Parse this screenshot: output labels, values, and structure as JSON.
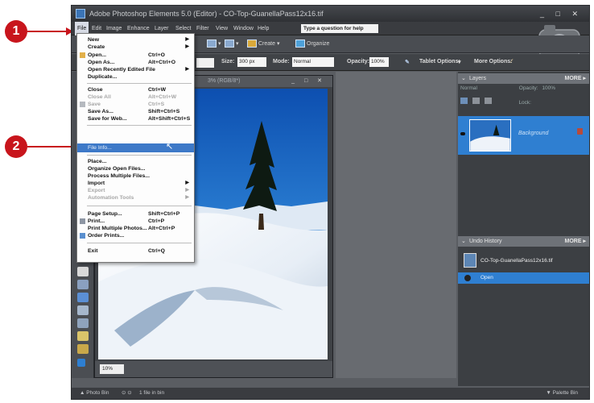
{
  "window": {
    "title": "Adobe Photoshop Elements 5.0 (Editor) - CO-Top-GuanellaPass12x16.tif",
    "controls": "_ □ ✕"
  },
  "menubar": {
    "items": [
      "File",
      "Edit",
      "Image",
      "Enhance",
      "Layer",
      "Select",
      "Filter",
      "View",
      "Window",
      "Help"
    ],
    "help_placeholder": "Type a question for help"
  },
  "shortcuts": {
    "create_label": "Create",
    "organize_label": "Organize"
  },
  "options_bar": {
    "size_label": "Size:",
    "size_value": "300 px",
    "mode_label": "Mode:",
    "mode_value": "Normal",
    "opacity_label": "Opacity:",
    "opacity_value": "100%",
    "tablet_label": "Tablet Options:",
    "more_label": "More Options:"
  },
  "document": {
    "title_suffix": "3% (RGB/8*)",
    "controls": "_ □ ✕",
    "zoom": "10%"
  },
  "file_menu": {
    "items": [
      {
        "label": "New",
        "shortcut": "",
        "submenu": true,
        "disabled": false
      },
      {
        "label": "Create",
        "shortcut": "",
        "submenu": true,
        "disabled": false
      },
      {
        "label": "Open...",
        "shortcut": "Ctrl+O",
        "submenu": false,
        "disabled": false
      },
      {
        "label": "Open As...",
        "shortcut": "Alt+Ctrl+O",
        "submenu": false,
        "disabled": false
      },
      {
        "label": "Open Recently Edited File",
        "shortcut": "",
        "submenu": true,
        "disabled": false
      },
      {
        "label": "Duplicate...",
        "shortcut": "",
        "submenu": false,
        "disabled": false
      },
      {
        "label": "Close",
        "shortcut": "Ctrl+W",
        "submenu": false,
        "disabled": false
      },
      {
        "label": "Close All",
        "shortcut": "Alt+Ctrl+W",
        "submenu": false,
        "disabled": true
      },
      {
        "label": "Save",
        "shortcut": "Ctrl+S",
        "submenu": false,
        "disabled": true
      },
      {
        "label": "Save As...",
        "shortcut": "Shift+Ctrl+S",
        "submenu": false,
        "disabled": false
      },
      {
        "label": "Save for Web...",
        "shortcut": "Alt+Shift+Ctrl+S",
        "submenu": false,
        "disabled": false
      },
      {
        "label": "File Info...",
        "shortcut": "",
        "submenu": false,
        "disabled": false,
        "highlighted": true
      },
      {
        "label": "Place...",
        "shortcut": "",
        "submenu": false,
        "disabled": false
      },
      {
        "label": "Organize Open Files...",
        "shortcut": "",
        "submenu": false,
        "disabled": false
      },
      {
        "label": "Process Multiple Files...",
        "shortcut": "",
        "submenu": false,
        "disabled": false
      },
      {
        "label": "Import",
        "shortcut": "",
        "submenu": true,
        "disabled": false
      },
      {
        "label": "Export",
        "shortcut": "",
        "submenu": true,
        "disabled": true
      },
      {
        "label": "Automation Tools",
        "shortcut": "",
        "submenu": true,
        "disabled": true
      },
      {
        "label": "Page Setup...",
        "shortcut": "Shift+Ctrl+P",
        "submenu": false,
        "disabled": false
      },
      {
        "label": "Print...",
        "shortcut": "Ctrl+P",
        "submenu": false,
        "disabled": false
      },
      {
        "label": "Print Multiple Photos...",
        "shortcut": "Alt+Ctrl+P",
        "submenu": false,
        "disabled": false
      },
      {
        "label": "Order Prints...",
        "shortcut": "",
        "submenu": false,
        "disabled": false
      },
      {
        "label": "Exit",
        "shortcut": "Ctrl+Q",
        "submenu": false,
        "disabled": false
      }
    ]
  },
  "layers_panel": {
    "title": "Layers",
    "more": "MORE ▸",
    "blend_mode": "Normal",
    "opacity_label": "Opacity:",
    "opacity_value": "100%",
    "lock_label": "Lock:",
    "layer_name": "Background"
  },
  "undo_panel": {
    "title": "Undo History",
    "more": "MORE ▸",
    "items": [
      "CO-Top-GuanellaPass12x16.tif",
      "Open"
    ]
  },
  "bottom_bar": {
    "photo_bin": "Photo Bin",
    "files_count": "1 file in bin",
    "palette_bin": "Palette Bin"
  },
  "callouts": [
    "1",
    "2"
  ],
  "colors": {
    "highlight": "#3d79c8",
    "callout": "#c8151c",
    "layer_selected": "#2f7fd1"
  }
}
